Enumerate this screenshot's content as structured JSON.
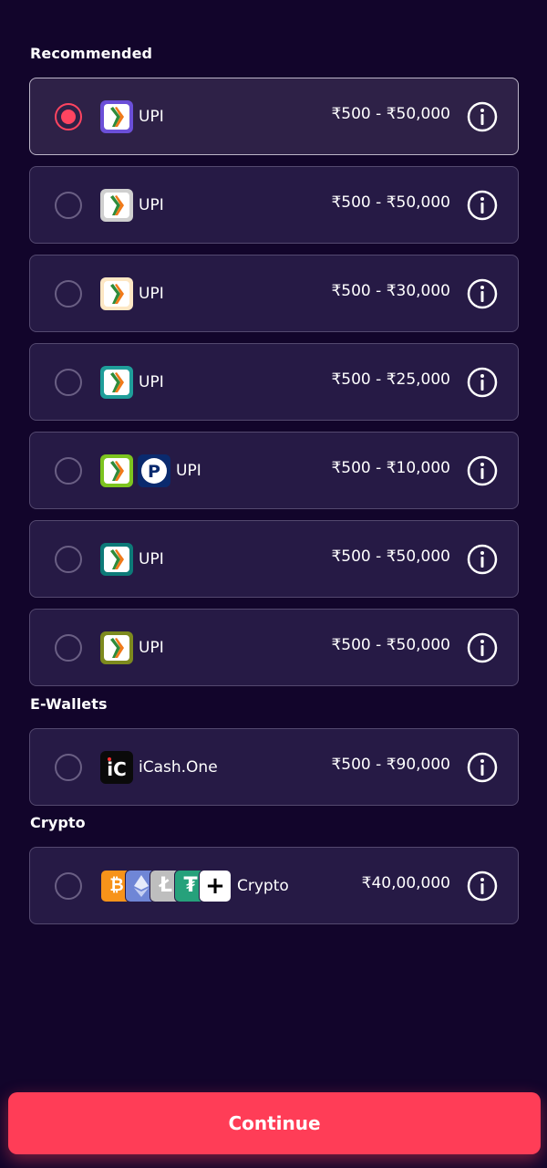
{
  "sections": {
    "recommended": "Recommended",
    "ewallets": "E-Wallets",
    "crypto": "Crypto"
  },
  "recommended": [
    {
      "name": "UPI",
      "range": "₹500 - ₹50,000",
      "selected": true,
      "icon": "upi-icon",
      "logo_bg": "#6b4fd8"
    },
    {
      "name": "UPI",
      "range": "₹500 - ₹50,000",
      "selected": false,
      "icon": "upi-icon",
      "logo_bg": "#cfcfcf"
    },
    {
      "name": "UPI",
      "range": "₹500 - ₹30,000",
      "selected": false,
      "icon": "upi-icon",
      "logo_bg": "#fde7c4"
    },
    {
      "name": "UPI",
      "range": "₹500 - ₹25,000",
      "selected": false,
      "icon": "upi-icon",
      "logo_bg": "#1f9e9a"
    },
    {
      "name": "UPI",
      "range": "₹500 - ₹10,000",
      "selected": false,
      "icon": "upi-icon",
      "logo_bg": "#7cc41f",
      "extra_icon": "paytm-p-icon"
    },
    {
      "name": "UPI",
      "range": "₹500 - ₹50,000",
      "selected": false,
      "icon": "upi-icon",
      "logo_bg": "#0d7a78"
    },
    {
      "name": "UPI",
      "range": "₹500 - ₹50,000",
      "selected": false,
      "icon": "upi-icon",
      "logo_bg": "#7d8a1e"
    }
  ],
  "ewallets": [
    {
      "name": "iCash.One",
      "range": "₹500 - ₹90,000",
      "selected": false,
      "icon": "icash-icon"
    }
  ],
  "crypto": [
    {
      "name": "Crypto",
      "range": "₹40,00,000",
      "selected": false,
      "icons": [
        "bitcoin-icon",
        "ethereum-icon",
        "litecoin-icon",
        "tether-icon",
        "plus-icon"
      ]
    }
  ],
  "continue_label": "Continue",
  "colors": {
    "background": "#12052b",
    "card": "#261a45",
    "accent": "#ff3d57"
  }
}
